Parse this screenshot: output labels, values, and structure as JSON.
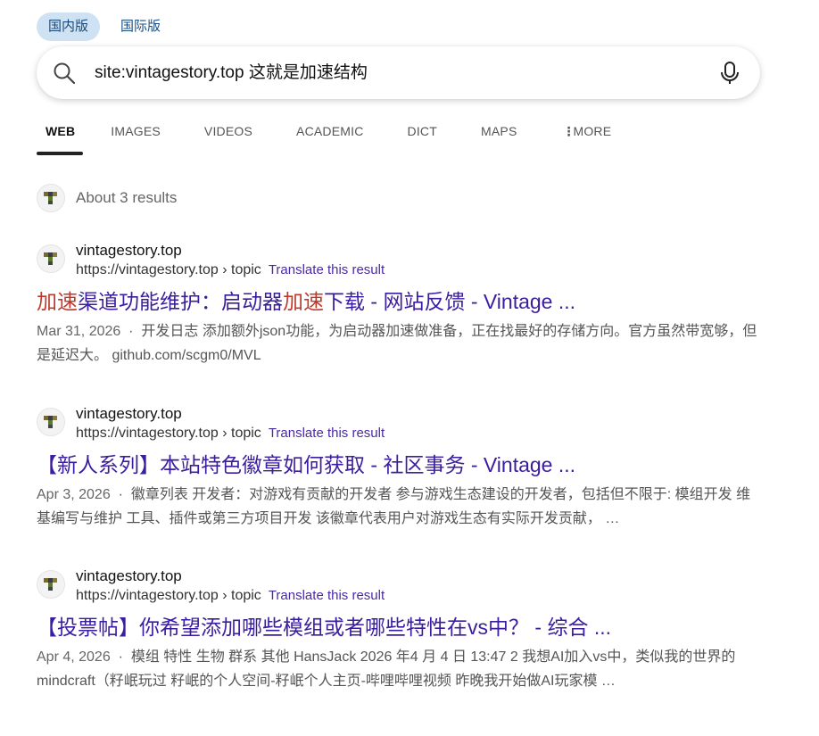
{
  "region": {
    "domestic": "国内版",
    "international": "国际版",
    "active": "domestic"
  },
  "search": {
    "query": "site:vintagestory.top  这就是加速结构"
  },
  "tabs": {
    "web": "WEB",
    "images": "IMAGES",
    "videos": "VIDEOS",
    "academic": "ACADEMIC",
    "dict": "DICT",
    "maps": "MAPS",
    "more": "MORE",
    "active": "web"
  },
  "results_count": "About 3 results",
  "results": [
    {
      "site": "vintagestory.top",
      "url": "https://vintagestory.top › topic",
      "translate": "Translate this result",
      "title_parts": [
        "加速",
        "渠道功能维护：启动器",
        "加速",
        "下载 - 网站反馈 - Vintage ..."
      ],
      "date": "Mar 31, 2026",
      "snippet": "开发日志 添加额外json功能，为启动器加速做准备，正在找最好的存储方向。官方虽然带宽够，但是延迟大。 github.com/scgm0/MVL"
    },
    {
      "site": "vintagestory.top",
      "url": "https://vintagestory.top › topic",
      "translate": "Translate this result",
      "title": "【新人系列】本站特色徽章如何获取 - 社区事务 - Vintage ...",
      "date": "Apr 3, 2026",
      "snippet": "徽章列表 开发者：对游戏有贡献的开发者 参与游戏生态建设的开发者，包括但不限于: 模组开发 维基编写与维护 工具、插件或第三方项目开发 该徽章代表用户对游戏生态有实际开发贡献， …"
    },
    {
      "site": "vintagestory.top",
      "url": "https://vintagestory.top › topic",
      "translate": "Translate this result",
      "title": "【投票帖】你希望添加哪些模组或者哪些特性在vs中？ - 综合 ...",
      "date": "Apr 4, 2026",
      "snippet": "模组 特性 生物 群系 其他 HansJack 2026 年4 月 4 日 13:47 2 我想AI加入vs中，类似我的世界的mindcraft（籽岷玩过 籽岷的个人空间-籽岷个人主页-哔哩哔哩视频 昨晚我开始做AI玩家模 …"
    }
  ]
}
